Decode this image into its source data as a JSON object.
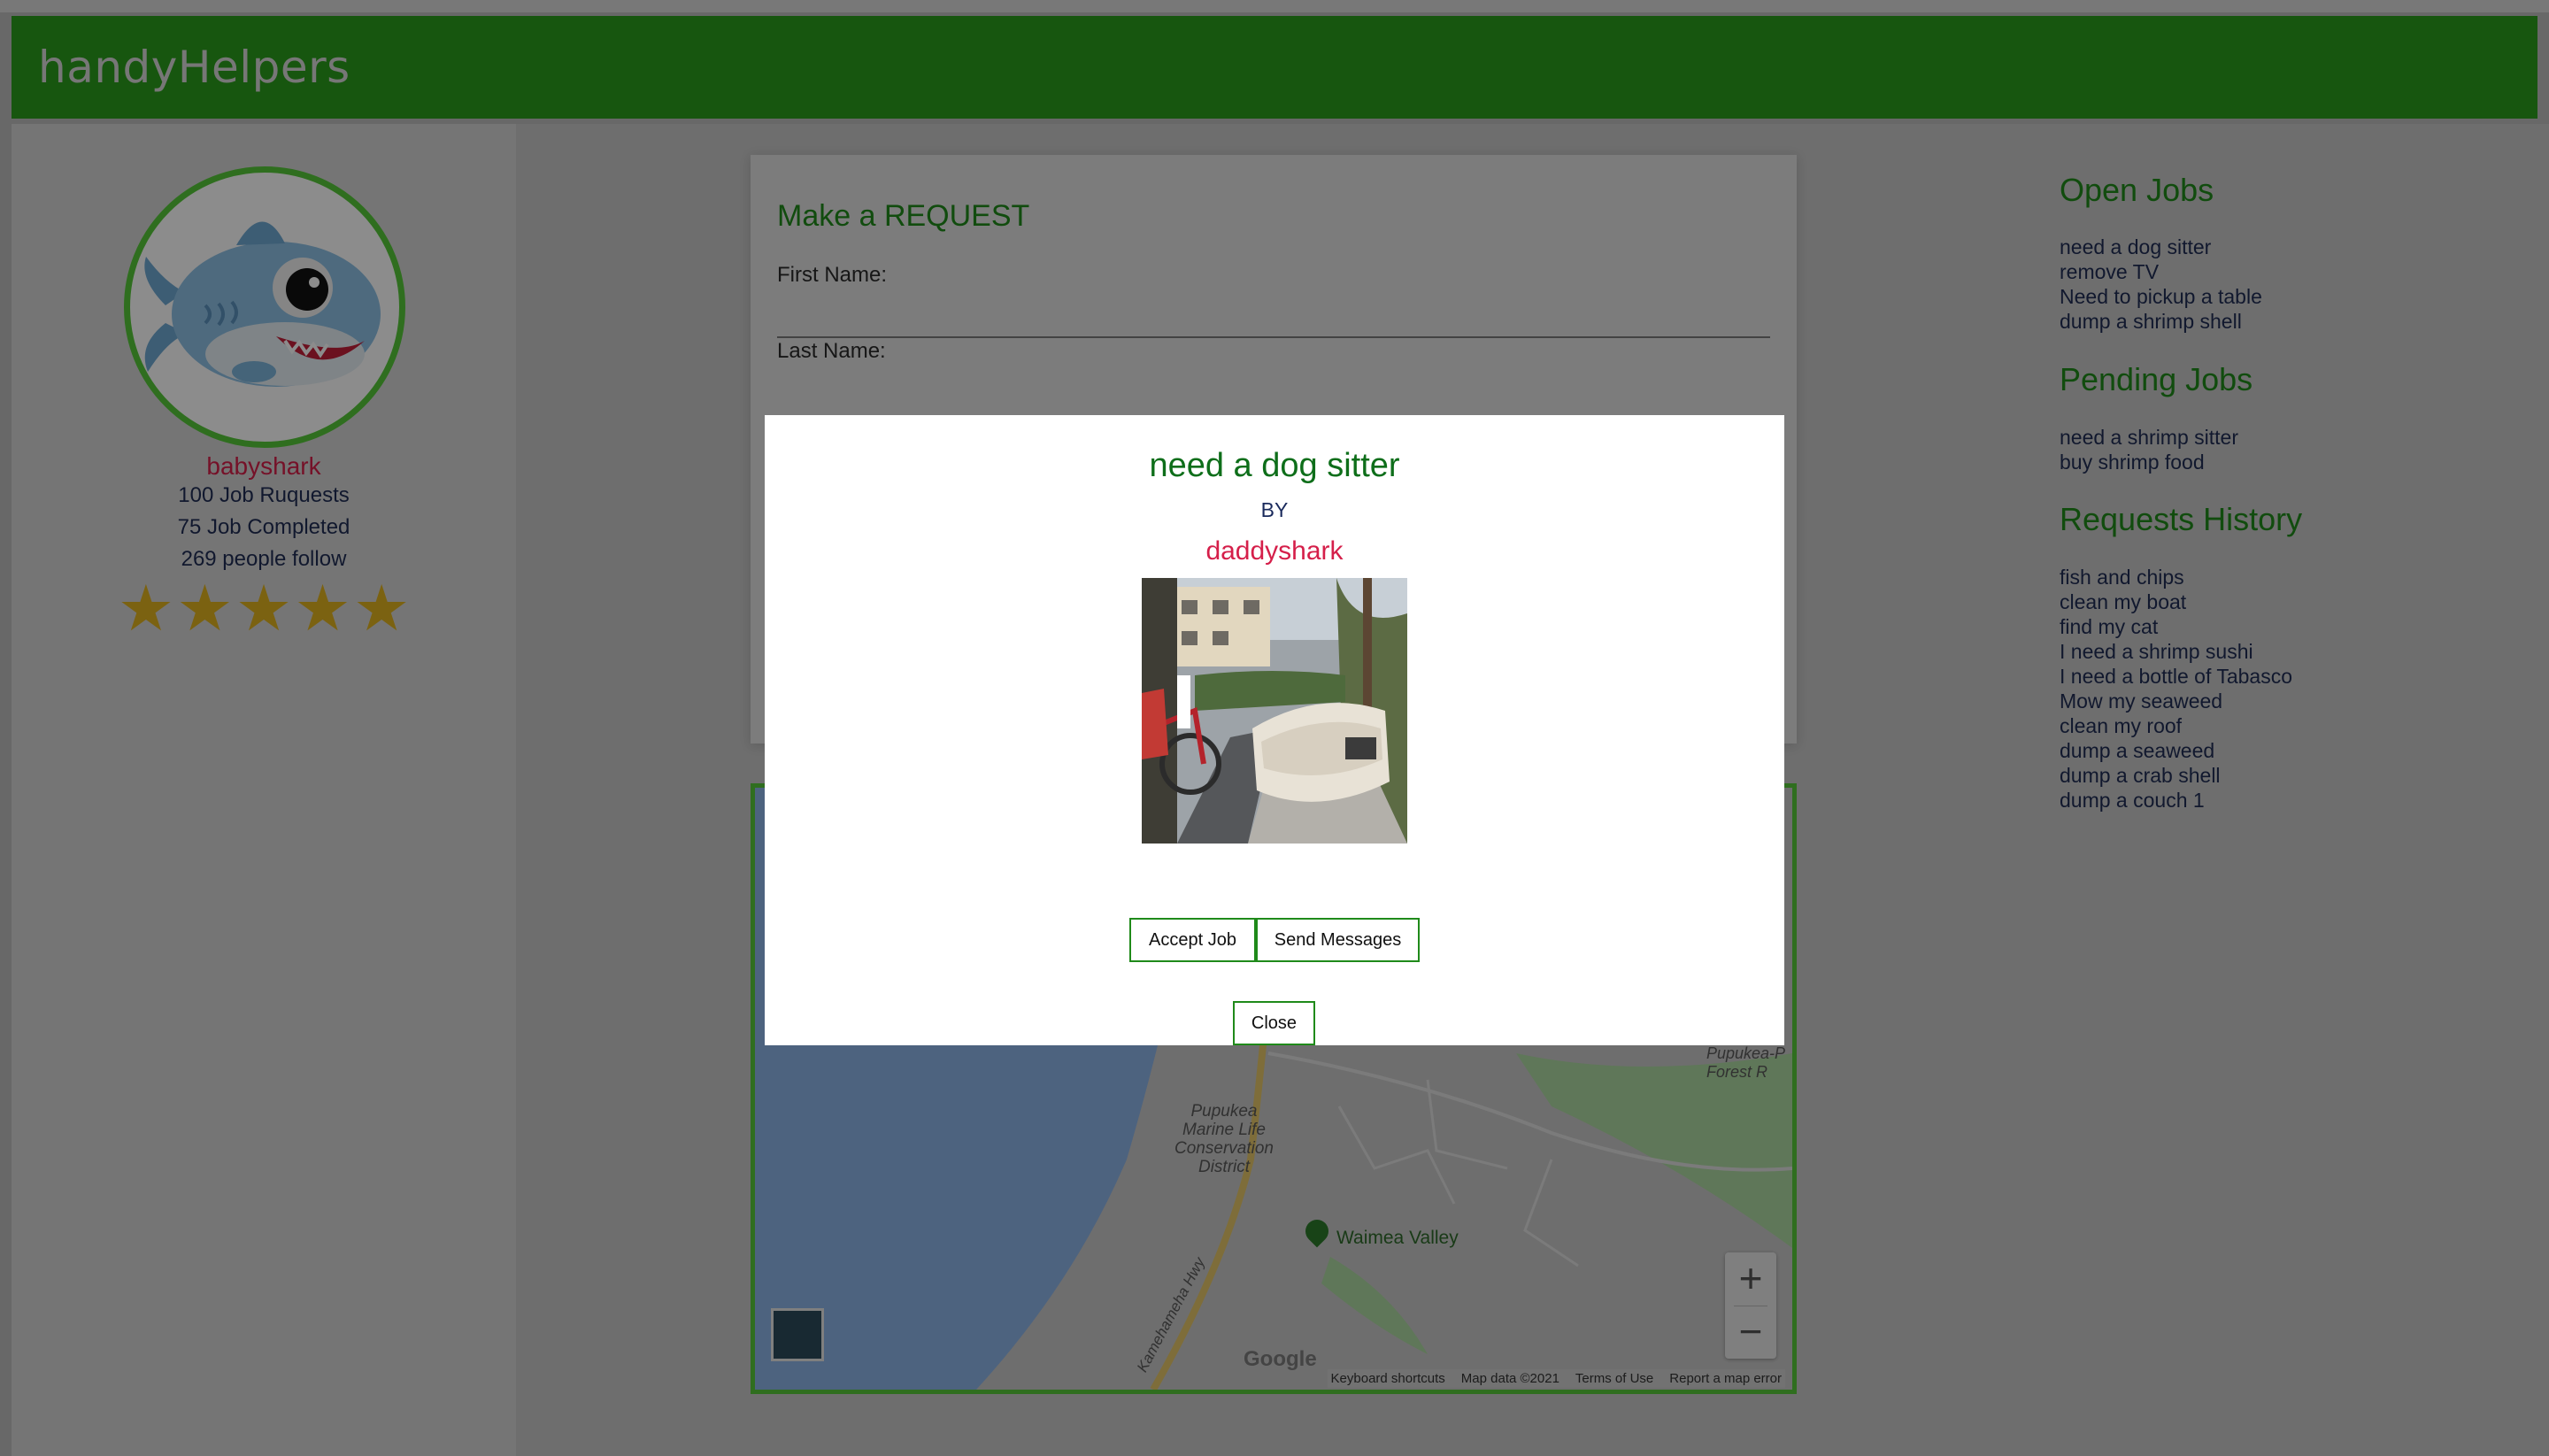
{
  "app": {
    "brand": "handyHelpers"
  },
  "profile": {
    "name": "babyshark",
    "requests": "100 Job Ruquests",
    "completed": "75 Job Completed",
    "followers": "269 people follow",
    "rating_stars": 5,
    "star_glyph": "★"
  },
  "request_form": {
    "title": "Make a REQUEST",
    "first_name_label": "First Name:",
    "last_name_label": "Last Name:"
  },
  "map": {
    "labels": {
      "conservation": "Pupukea\nMarine Life\nConservation\nDistrict",
      "valley": "Waimea Valley",
      "forest": "Pupukea-P\nForest R",
      "highway": "Kamehameha Hwy"
    },
    "zoom_in": "+",
    "zoom_out": "−",
    "logo": "Google",
    "attribution": {
      "shortcuts": "Keyboard shortcuts",
      "map_data": "Map data ©2021",
      "terms": "Terms of Use",
      "report": "Report a map error"
    }
  },
  "open_jobs": {
    "heading": "Open Jobs",
    "items": [
      "need a dog sitter",
      "remove TV",
      "Need to pickup a table",
      "dump a shrimp shell"
    ]
  },
  "pending_jobs": {
    "heading": "Pending Jobs",
    "items": [
      "need a shrimp sitter",
      "buy shrimp food"
    ]
  },
  "requests_history": {
    "heading": "Requests History",
    "items": [
      "fish and chips",
      "clean my boat",
      "find my cat",
      "I need a shrimp sushi",
      "I need a bottle of Tabasco",
      "Mow my seaweed",
      "clean my roof",
      "dump a seaweed",
      "dump a crab shell",
      "dump a couch 1"
    ]
  },
  "modal": {
    "title": "need a dog sitter",
    "by": "BY",
    "author": "daddyshark",
    "accept_label": "Accept Job",
    "message_label": "Send Messages",
    "close_label": "Close"
  },
  "colors": {
    "header": "#2a9d1d",
    "accent_green": "#1f8a1a",
    "name_pink": "#d51f4a",
    "star": "#e1b21f"
  }
}
